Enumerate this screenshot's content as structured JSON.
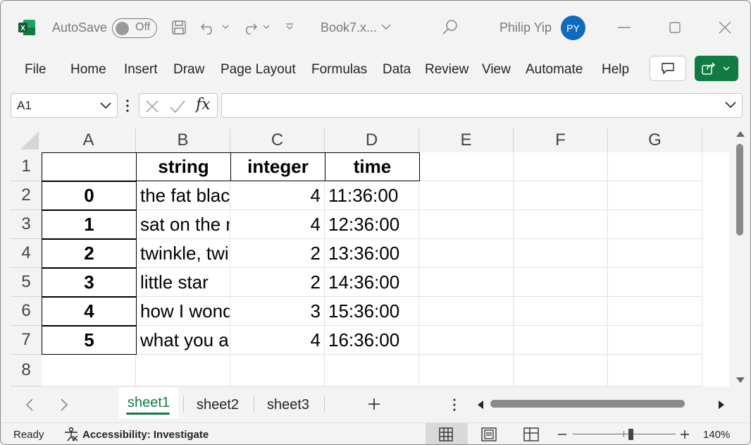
{
  "titlebar": {
    "autosave_label": "AutoSave",
    "autosave_state": "Off",
    "filename": "Book7.x...",
    "user_name": "Philip Yip",
    "avatar_initials": "PY"
  },
  "ribbon": {
    "tabs": [
      "File",
      "Home",
      "Insert",
      "Draw",
      "Page Layout",
      "Formulas",
      "Data",
      "Review",
      "View",
      "Automate",
      "Help"
    ]
  },
  "formula_bar": {
    "name_box": "A1",
    "fx_label": "fx",
    "formula_value": ""
  },
  "grid": {
    "columns": [
      "A",
      "B",
      "C",
      "D",
      "E",
      "F",
      "G"
    ],
    "rows": [
      "1",
      "2",
      "3",
      "4",
      "5",
      "6",
      "7",
      "8"
    ],
    "header_row": {
      "b": "string",
      "c": "integer",
      "d": "time"
    },
    "data": [
      {
        "a": "0",
        "b": "the fat black cat",
        "c": "4",
        "d": "11:36:00"
      },
      {
        "a": "1",
        "b": "sat on the mat",
        "c": "4",
        "d": "12:36:00"
      },
      {
        "a": "2",
        "b": "twinkle, twinkle",
        "c": "2",
        "d": "13:36:00"
      },
      {
        "a": "3",
        "b": "little star",
        "c": "2",
        "d": "14:36:00"
      },
      {
        "a": "4",
        "b": "how I wonder",
        "c": "3",
        "d": "15:36:00"
      },
      {
        "a": "5",
        "b": "what you are",
        "c": "4",
        "d": "16:36:00"
      }
    ]
  },
  "sheets": {
    "tabs": [
      "sheet1",
      "sheet2",
      "sheet3"
    ],
    "active": "sheet1"
  },
  "status": {
    "ready": "Ready",
    "accessibility": "Accessibility: Investigate",
    "zoom": "140%"
  },
  "colors": {
    "excel_green": "#107c41",
    "avatar_blue": "#0f6cbd"
  }
}
